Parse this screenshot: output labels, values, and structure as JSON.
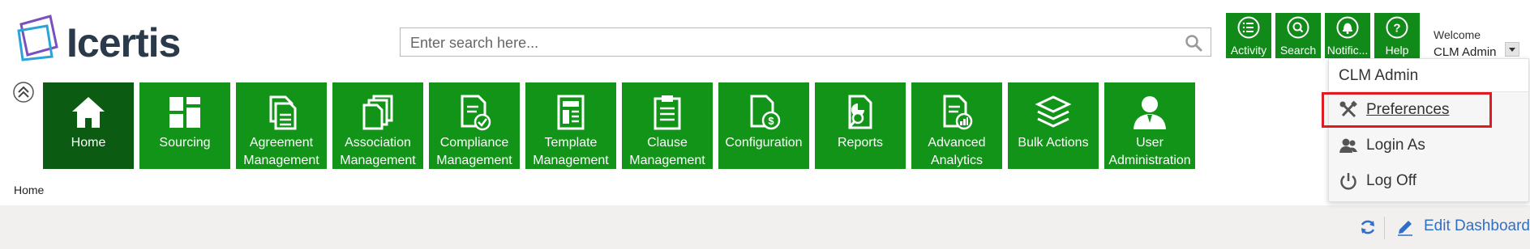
{
  "brand": {
    "name": "Icertis"
  },
  "search": {
    "placeholder": "Enter search here..."
  },
  "top_actions": [
    {
      "label": "Activity",
      "icon": "activity-list-icon"
    },
    {
      "label": "Search",
      "icon": "search-icon"
    },
    {
      "label": "Notific...",
      "icon": "bell-icon"
    },
    {
      "label": "Help",
      "icon": "help-icon"
    }
  ],
  "user": {
    "welcome": "Welcome",
    "name": "CLM Admin"
  },
  "modules": [
    {
      "label": "Home",
      "icon": "home-icon",
      "active": true
    },
    {
      "label": "Sourcing",
      "icon": "sourcing-grid-icon"
    },
    {
      "label": "Agreement Management",
      "icon": "agreement-document-icon"
    },
    {
      "label": "Association Management",
      "icon": "association-documents-icon"
    },
    {
      "label": "Compliance Management",
      "icon": "compliance-document-icon"
    },
    {
      "label": "Template Management",
      "icon": "template-document-icon"
    },
    {
      "label": "Clause Management",
      "icon": "clause-clipboard-icon"
    },
    {
      "label": "Configuration",
      "icon": "configuration-document-icon"
    },
    {
      "label": "Reports",
      "icon": "reports-icon"
    },
    {
      "label": "Advanced Analytics",
      "icon": "analytics-document-icon"
    },
    {
      "label": "Bulk Actions",
      "icon": "layers-icon"
    },
    {
      "label": "User Administration",
      "icon": "user-admin-icon"
    }
  ],
  "breadcrumb": {
    "current": "Home"
  },
  "dashboard": {
    "edit_label": "Edit Dashboard"
  },
  "user_menu": {
    "header": "CLM Admin",
    "items": [
      {
        "label": "Preferences",
        "icon": "wrench-tools-icon",
        "highlighted": true
      },
      {
        "label": "Login As",
        "icon": "users-icon"
      },
      {
        "label": "Log Off",
        "icon": "power-icon"
      }
    ]
  },
  "colors": {
    "accent_green": "#129418",
    "active_green": "#0b5b12",
    "link_blue": "#2f6fc7",
    "highlight_red": "#e21b23"
  }
}
